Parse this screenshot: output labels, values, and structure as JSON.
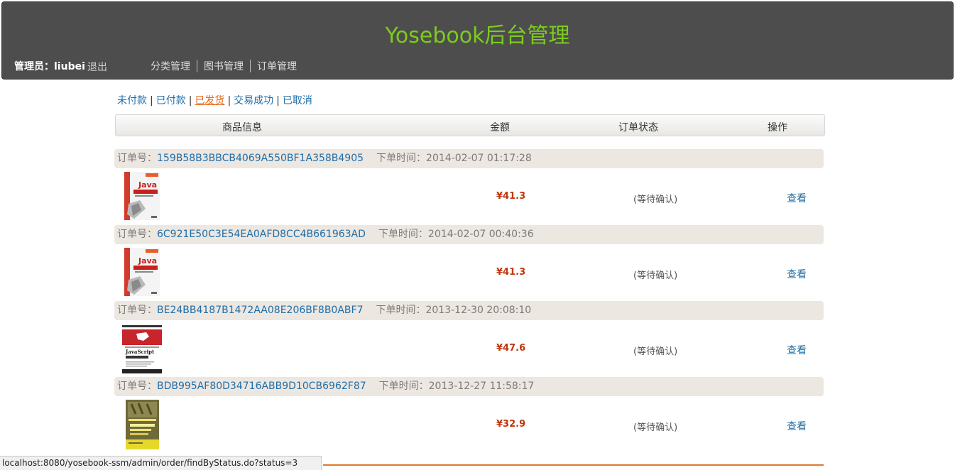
{
  "header": {
    "title": "Yosebook后台管理",
    "admin_label": "管理员：liubei",
    "logout_label": "退出",
    "nav": [
      "分类管理",
      "图书管理",
      "订单管理"
    ]
  },
  "status_tabs": {
    "unpaid": "未付款",
    "paid": "已付款",
    "shipped": "已发货",
    "completed": "交易成功",
    "cancelled": "已取消",
    "active": "shipped"
  },
  "table": {
    "headers": [
      "商品信息",
      "金额",
      "订单状态",
      "操作"
    ]
  },
  "orders": [
    {
      "id_label": "订单号：",
      "id": "159B58B3BBCB4069A550BF1A358B4905",
      "time_label": "下单时间：",
      "time": "2014-02-07 01:17:28",
      "book_cover": "java-cover",
      "price": "¥41.3",
      "status": "(等待确认)",
      "action": "查看"
    },
    {
      "id_label": "订单号：",
      "id": "6C921E50C3E54EA0AFD8CC4B661963AD",
      "time_label": "下单时间：",
      "time": "2014-02-07 00:40:36",
      "book_cover": "java-cover",
      "price": "¥41.3",
      "status": "(等待确认)",
      "action": "查看"
    },
    {
      "id_label": "订单号：",
      "id": "BE24BB4187B1472AA08E206BF8B0ABF7",
      "time_label": "下单时间：",
      "time": "2013-12-30 20:08:10",
      "book_cover": "javascript-cover",
      "price": "¥47.6",
      "status": "(等待确认)",
      "action": "查看"
    },
    {
      "id_label": "订单号：",
      "id": "BDB995AF80D34716ABB9D10CB6962F87",
      "time_label": "下单时间：",
      "time": "2013-12-27 11:58:17",
      "book_cover": "html-css-cover",
      "price": "¥32.9",
      "status": "(等待确认)",
      "action": "查看"
    }
  ],
  "statusbar": {
    "url": "localhost:8080/yosebook-ssm/admin/order/findByStatus.do?status=3"
  },
  "colors": {
    "header_bg": "#4d4d4d",
    "title": "#7ccc1c",
    "link": "#1f6ea8",
    "active_tab": "#e46a1b",
    "price": "#c0360c",
    "order_bar_bg": "#ede7e1"
  }
}
